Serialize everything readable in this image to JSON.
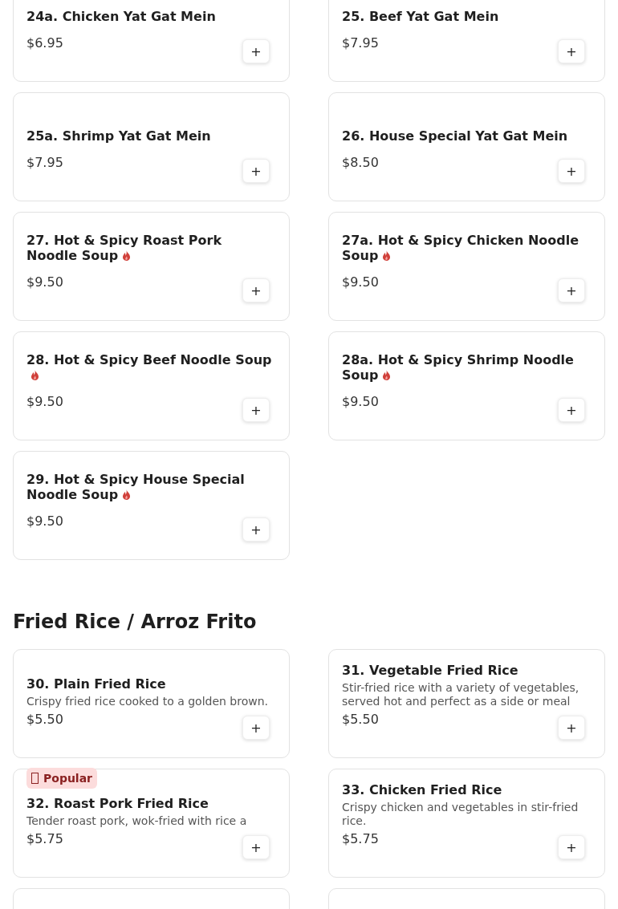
{
  "sections": [
    {
      "items": [
        {
          "kind": "dish",
          "name": "24a. Chicken Yat Gat Mein",
          "price": "$6.95",
          "spicy": false,
          "add": "+"
        },
        {
          "kind": "dish",
          "name": "25. Beef Yat Gat Mein",
          "price": "$7.95",
          "spicy": false,
          "add": "+"
        },
        {
          "kind": "dish",
          "name": "25a. Shrimp Yat Gat Mein",
          "price": "$7.95",
          "spicy": false,
          "add": "+"
        },
        {
          "kind": "dish",
          "name": "26. House Special Yat Gat Mein",
          "price": "$8.50",
          "spicy": false,
          "add": "+"
        },
        {
          "kind": "dish",
          "name": "27. Hot & Spicy Roast Pork Noodle Soup",
          "price": "$9.50",
          "spicy": true,
          "add": "+"
        },
        {
          "kind": "dish",
          "name": "27a. Hot & Spicy Chicken Noodle Soup",
          "price": "$9.50",
          "spicy": true,
          "add": "+"
        },
        {
          "kind": "dish",
          "name": "28. Hot & Spicy Beef Noodle Soup",
          "price": "$9.50",
          "spicy": true,
          "add": "+"
        },
        {
          "kind": "dish",
          "name": "28a. Hot & Spicy Shrimp Noodle Soup",
          "price": "$9.50",
          "spicy": true,
          "add": "+"
        },
        {
          "kind": "dish",
          "name": "29. Hot & Spicy House Special Noodle Soup",
          "price": "$9.50",
          "spicy": true,
          "add": "+"
        }
      ]
    },
    {
      "title": "Fried Rice / Arroz Frito",
      "items": [
        {
          "kind": "dish",
          "name": "30. Plain Fried Rice",
          "description": "Crispy fried rice cooked to a golden brown.",
          "price": "$5.50",
          "spicy": false,
          "add": "+"
        },
        {
          "kind": "dish",
          "name": "31. Vegetable Fried Rice",
          "description": "Stir-fried rice with a variety of vegetables, served hot and perfect as a side or meal",
          "price": "$5.50",
          "spicy": false,
          "add": "+"
        },
        {
          "kind": "dish",
          "badge": "Popular",
          "name": "32. Roast Pork Fried Rice",
          "description": "Tender roast pork, wok-fried with rice a",
          "price": "$5.75",
          "spicy": false,
          "add": "+"
        },
        {
          "kind": "dish",
          "name": "33. Chicken Fried Rice",
          "description": "Crispy chicken and vegetables in stir-fried rice.",
          "price": "$5.75",
          "spicy": false,
          "add": "+"
        },
        {
          "kind": "partial"
        },
        {
          "kind": "partial"
        }
      ]
    }
  ]
}
